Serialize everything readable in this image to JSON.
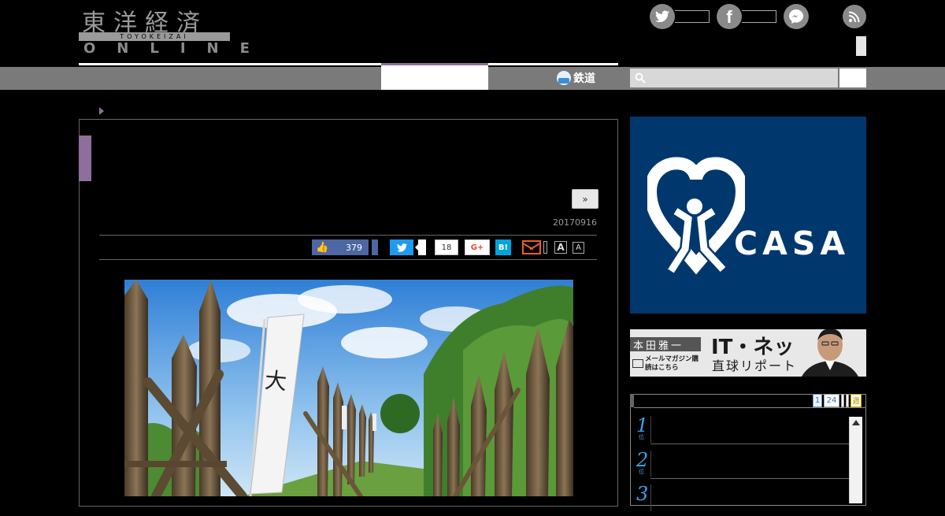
{
  "header": {
    "logo_kanji": "東洋経済",
    "logo_band": "TOYOKEIZAI",
    "logo_online": "ONLINE",
    "social_icons": [
      "twitter-icon",
      "facebook-icon",
      "messenger-icon",
      "rss-icon"
    ]
  },
  "nav": {
    "rail_label": "鉄道",
    "search_placeholder": ""
  },
  "article": {
    "next_label": "»",
    "date": "20170916",
    "share": {
      "like_count": "379",
      "hatena_count": "18",
      "gplus_label": "G+",
      "hatena_label": "B!",
      "font_large": "A",
      "font_small": "A"
    }
  },
  "sidebar": {
    "ad_brand": "CASA",
    "ad_reg": "®",
    "banner": {
      "author": "本田雅一",
      "magazine": "メールマガジン購読はこちら",
      "title_line1": "IT・ネット",
      "title_line2": "直球リポート"
    },
    "ranking": {
      "tabs": [
        "1",
        "24",
        "週"
      ],
      "items": [
        {
          "rank": "1",
          "sub": "位"
        },
        {
          "rank": "2",
          "sub": "位"
        },
        {
          "rank": "3",
          "sub": "位"
        }
      ]
    }
  },
  "colors": {
    "accent_purple": "#8e6f9b",
    "nav_gray": "#7a7a7a",
    "facebook_blue": "#4c67a1",
    "twitter_blue": "#1d9bf0",
    "hatena_blue": "#00a4de",
    "casa_navy": "#00386e",
    "rank_blue": "#3aa3e8"
  }
}
